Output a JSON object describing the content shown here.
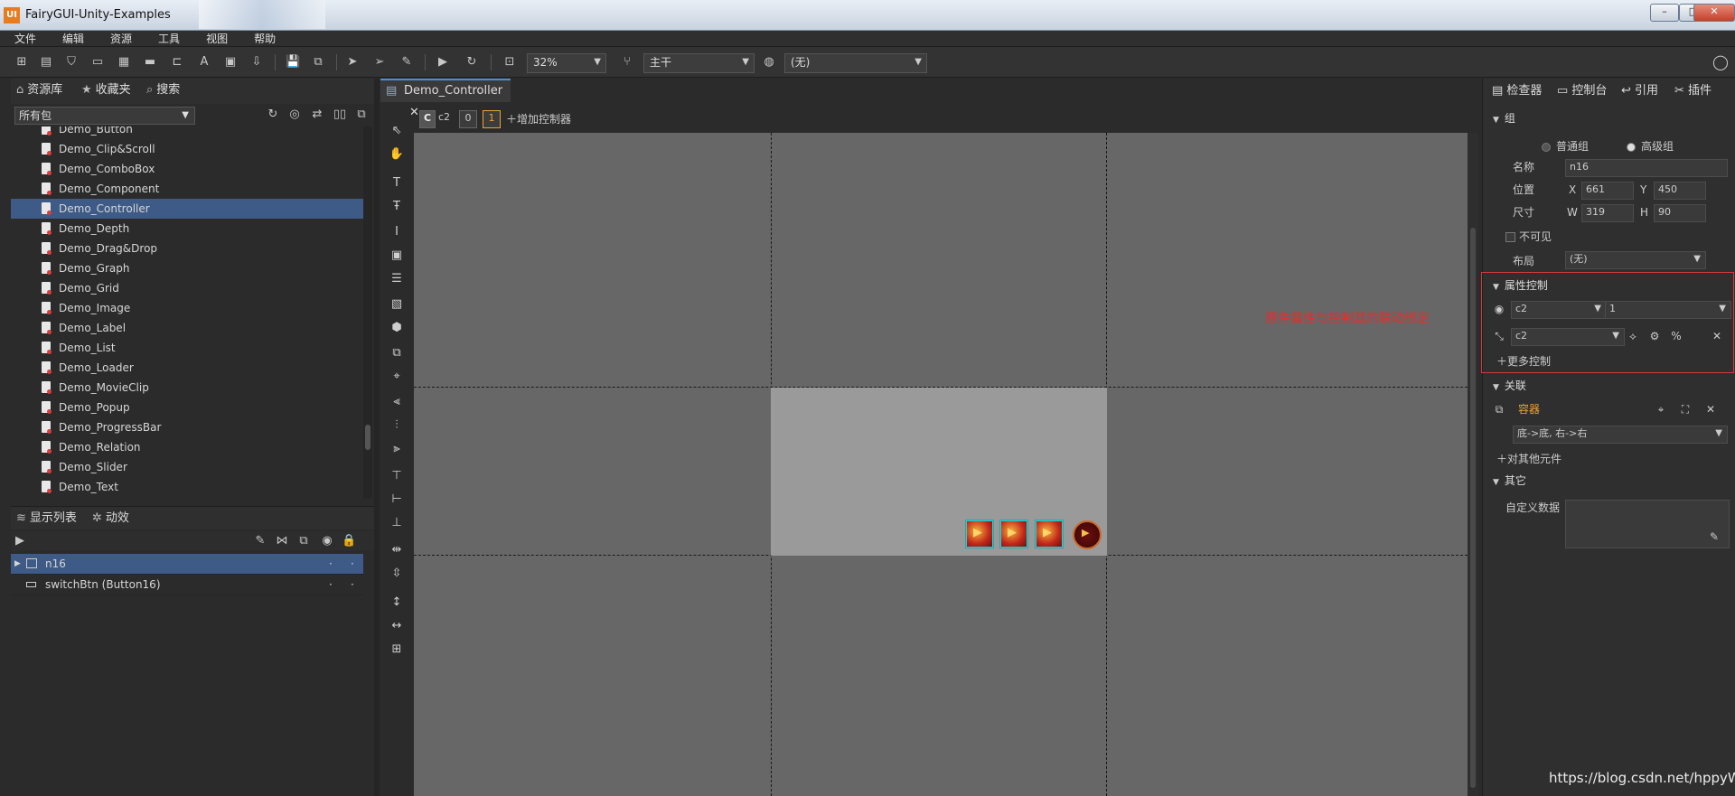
{
  "window": {
    "title": "FairyGUI-Unity-Examples"
  },
  "menu": [
    "文件",
    "编辑",
    "资源",
    "工具",
    "视图",
    "帮助"
  ],
  "toolbar": {
    "zoom": "32%",
    "branch": "主干",
    "language": "(无)"
  },
  "library": {
    "tabs": [
      "资源库",
      "收藏夹",
      "搜索"
    ],
    "package_filter": "所有包",
    "items": [
      "Demo_Button",
      "Demo_Clip&Scroll",
      "Demo_ComboBox",
      "Demo_Component",
      "Demo_Controller",
      "Demo_Depth",
      "Demo_Drag&Drop",
      "Demo_Graph",
      "Demo_Grid",
      "Demo_Image",
      "Demo_Label",
      "Demo_List",
      "Demo_Loader",
      "Demo_MovieClip",
      "Demo_Popup",
      "Demo_ProgressBar",
      "Demo_Relation",
      "Demo_Slider",
      "Demo_Text"
    ],
    "selected": "Demo_Controller"
  },
  "display_list": {
    "tabs": [
      "显示列表",
      "动效"
    ],
    "rows": [
      {
        "name": "n16"
      },
      {
        "name": "switchBtn (Button16)"
      }
    ]
  },
  "stage": {
    "tab": "Demo_Controller",
    "controller": {
      "badge": "C",
      "name": "c2",
      "page0": "0",
      "page1": "1",
      "add_label": "增加控制器"
    },
    "annotation": "原件属性与控制器的联动绑定",
    "annotation_color": "#e0302b"
  },
  "inspector": {
    "tabs": [
      "检查器",
      "控制台",
      "引用",
      "插件"
    ],
    "group": {
      "title": "组",
      "normal_group": "普通组",
      "advanced_group": "高级组",
      "name_label": "名称",
      "name_value": "n16",
      "pos_label": "位置",
      "x_label": "X",
      "x": "661",
      "y_label": "Y",
      "y": "450",
      "size_label": "尺寸",
      "w_label": "W",
      "w": "319",
      "h_label": "H",
      "h": "90",
      "invisible": "不可见",
      "layout_label": "布局",
      "layout_value": "(无)"
    },
    "gear": {
      "title": "属性控制",
      "row1_ctrl": "c2",
      "row1_page": "1",
      "row2_ctrl": "c2",
      "more": "更多控制"
    },
    "relation": {
      "title": "关联",
      "target": "容器",
      "target_color": "#e8a33a",
      "rule": "底->底, 右->右",
      "other": "对其他元件"
    },
    "other": {
      "title": "其它",
      "custom_data": "自定义数据"
    }
  },
  "watermark": "https://blog.csdn.net/hppyW"
}
